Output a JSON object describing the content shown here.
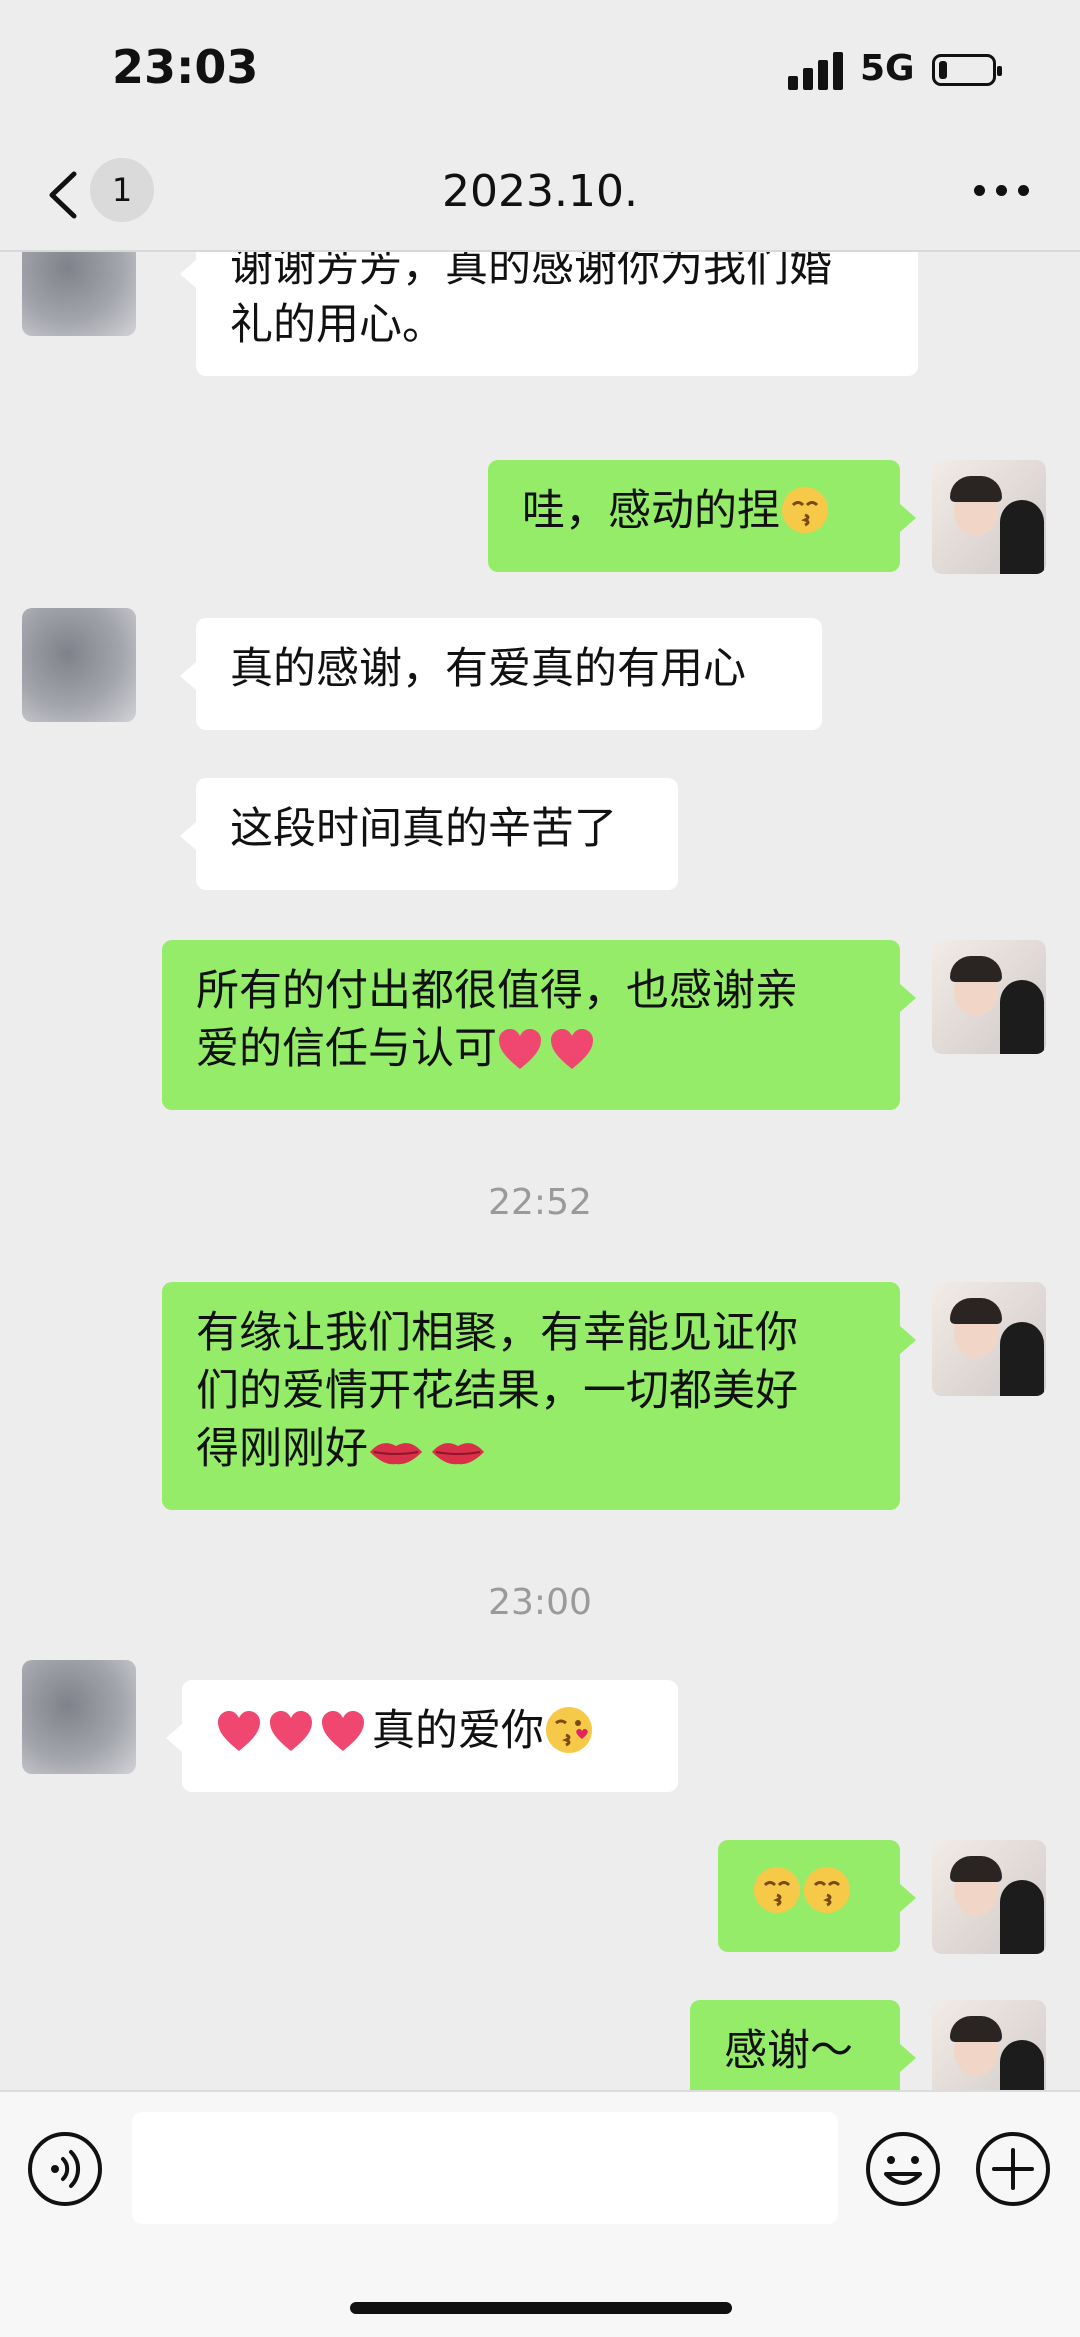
{
  "status_bar": {
    "time": "23:03",
    "network": "5G",
    "battery_level": 0.15
  },
  "header": {
    "unread_count": "1",
    "title": "2023.10.",
    "back_icon": "chevron-left-icon",
    "more_icon": "more-dots-icon"
  },
  "messages": [
    {
      "side": "in",
      "text": "谢谢芳芳，真的感谢你为我们婚",
      "text2": "礼的用心。"
    },
    {
      "side": "out",
      "text": "哇，感动的捏",
      "emoji": "kissing-face"
    },
    {
      "side": "in",
      "text": "真的感谢，有爱真的有用心"
    },
    {
      "side": "in",
      "text": "这段时间真的辛苦了"
    },
    {
      "side": "out",
      "text": "所有的付出都很值得，也感谢亲",
      "text2": "爱的信任与认可",
      "emoji": "heart x2"
    },
    {
      "side": "out",
      "text": "有缘让我们相聚，有幸能见证你",
      "text2": "们的爱情开花结果，一切都美好",
      "text3": "得刚刚好",
      "emoji": "lips x2"
    },
    {
      "side": "in",
      "text": "真的爱你",
      "emoji": "heart x3 + face-blowing-kiss"
    },
    {
      "side": "out",
      "text": "",
      "emoji": "kissing-face x2"
    },
    {
      "side": "out",
      "text": "感谢～"
    }
  ],
  "timestamps": [
    "22:52",
    "23:00"
  ],
  "input_bar": {
    "voice_icon": "voice-icon",
    "emoji_icon": "emoji-icon",
    "plus_icon": "plus-icon",
    "input_value": ""
  },
  "colors": {
    "background": "#ededed",
    "outgoing_bubble": "#95ec69",
    "incoming_bubble": "#ffffff",
    "timestamp_text": "#9a9a9a"
  }
}
